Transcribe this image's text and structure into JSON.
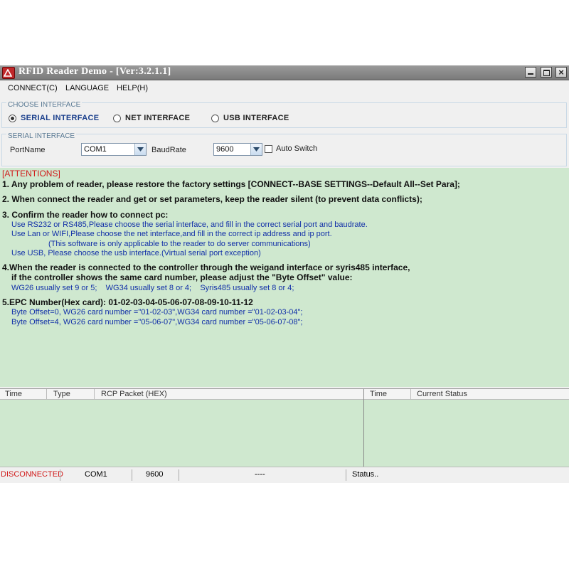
{
  "window": {
    "title": "RFID Reader Demo - [Ver:3.2.1.1]",
    "app_icon": "rfid-app-icon",
    "controls": {
      "minimize": "minimize-icon",
      "maximize": "maximize-icon",
      "close": "×"
    }
  },
  "menu": [
    "CONNECT(C)",
    "LANGUAGE",
    "HELP(H)"
  ],
  "choose_interface": {
    "title": "CHOOSE INTERFACE",
    "options": [
      {
        "label": "SERIAL INTERFACE",
        "selected": true
      },
      {
        "label": "NET INTERFACE",
        "selected": false
      },
      {
        "label": "USB INTERFACE",
        "selected": false
      }
    ]
  },
  "serial_interface": {
    "title": "SERIAL INTERFACE",
    "port_label": "PortName",
    "port_value": "COM1",
    "baud_label": "BaudRate",
    "baud_value": "9600",
    "auto_switch_label": "Auto Switch",
    "auto_switch_checked": false
  },
  "attentions": {
    "title": "[ATTENTIONS]",
    "lines": [
      "1. Any problem of reader, please restore the factory settings [CONNECT--BASE SETTINGS--Default All--Set Para];",
      "2. When connect the reader and get or set parameters, keep the reader silent (to prevent data conflicts);",
      "3. Confirm the reader how to connect pc:",
      "Use RS232 or RS485,Please choose the serial interface, and fill in the correct serial port and baudrate.",
      "Use Lan or WIFI,Please choose the net interface,and fill in the correct ip address and ip port.",
      "(This software is only applicable to the reader to do server communications)",
      "Use USB, Please choose the usb interface.(Virtual serial port exception)",
      "4.When the reader is connected to the controller through the weigand interface or syris485 interface,",
      "if the controller shows the same card number, please adjust the \"Byte Offset\" value:",
      "WG26 usually set 9 or 5;    WG34 usually set 8 or 4;    Syris485 usually set 8 or 4;",
      "5.EPC Number(Hex card): 01-02-03-04-05-06-07-08-09-10-11-12",
      "Byte Offset=0, WG26 card number =\"01-02-03\",WG34 card number =\"01-02-03-04\";",
      "Byte Offset=4, WG26 card number =\"05-06-07\",WG34 card number =\"05-06-07-08\";"
    ]
  },
  "packet_log": {
    "columns": [
      "Time",
      "Type",
      "RCP Packet (HEX)"
    ]
  },
  "status_log": {
    "columns": [
      "Time",
      "Current Status"
    ]
  },
  "statusbar": {
    "connection": "DISCONNECTED",
    "port": "COM1",
    "baud": "9600",
    "middle": "----",
    "status": "Status.."
  },
  "colors": {
    "attention_bg": "#cfe8cf",
    "attention_title": "#d01818",
    "note_text": "#1230a8",
    "disconnected": "#d01818"
  }
}
